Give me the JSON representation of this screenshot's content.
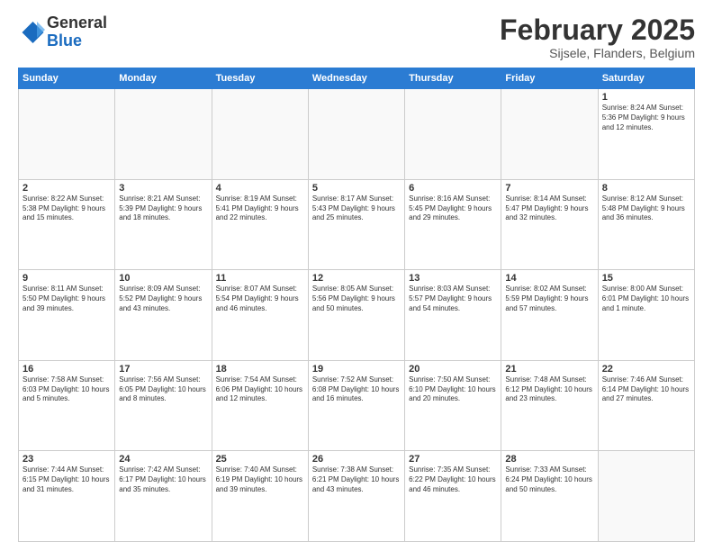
{
  "logo": {
    "general": "General",
    "blue": "Blue"
  },
  "title": "February 2025",
  "location": "Sijsele, Flanders, Belgium",
  "weekdays": [
    "Sunday",
    "Monday",
    "Tuesday",
    "Wednesday",
    "Thursday",
    "Friday",
    "Saturday"
  ],
  "weeks": [
    [
      {
        "day": "",
        "info": ""
      },
      {
        "day": "",
        "info": ""
      },
      {
        "day": "",
        "info": ""
      },
      {
        "day": "",
        "info": ""
      },
      {
        "day": "",
        "info": ""
      },
      {
        "day": "",
        "info": ""
      },
      {
        "day": "1",
        "info": "Sunrise: 8:24 AM\nSunset: 5:36 PM\nDaylight: 9 hours and 12 minutes."
      }
    ],
    [
      {
        "day": "2",
        "info": "Sunrise: 8:22 AM\nSunset: 5:38 PM\nDaylight: 9 hours and 15 minutes."
      },
      {
        "day": "3",
        "info": "Sunrise: 8:21 AM\nSunset: 5:39 PM\nDaylight: 9 hours and 18 minutes."
      },
      {
        "day": "4",
        "info": "Sunrise: 8:19 AM\nSunset: 5:41 PM\nDaylight: 9 hours and 22 minutes."
      },
      {
        "day": "5",
        "info": "Sunrise: 8:17 AM\nSunset: 5:43 PM\nDaylight: 9 hours and 25 minutes."
      },
      {
        "day": "6",
        "info": "Sunrise: 8:16 AM\nSunset: 5:45 PM\nDaylight: 9 hours and 29 minutes."
      },
      {
        "day": "7",
        "info": "Sunrise: 8:14 AM\nSunset: 5:47 PM\nDaylight: 9 hours and 32 minutes."
      },
      {
        "day": "8",
        "info": "Sunrise: 8:12 AM\nSunset: 5:48 PM\nDaylight: 9 hours and 36 minutes."
      }
    ],
    [
      {
        "day": "9",
        "info": "Sunrise: 8:11 AM\nSunset: 5:50 PM\nDaylight: 9 hours and 39 minutes."
      },
      {
        "day": "10",
        "info": "Sunrise: 8:09 AM\nSunset: 5:52 PM\nDaylight: 9 hours and 43 minutes."
      },
      {
        "day": "11",
        "info": "Sunrise: 8:07 AM\nSunset: 5:54 PM\nDaylight: 9 hours and 46 minutes."
      },
      {
        "day": "12",
        "info": "Sunrise: 8:05 AM\nSunset: 5:56 PM\nDaylight: 9 hours and 50 minutes."
      },
      {
        "day": "13",
        "info": "Sunrise: 8:03 AM\nSunset: 5:57 PM\nDaylight: 9 hours and 54 minutes."
      },
      {
        "day": "14",
        "info": "Sunrise: 8:02 AM\nSunset: 5:59 PM\nDaylight: 9 hours and 57 minutes."
      },
      {
        "day": "15",
        "info": "Sunrise: 8:00 AM\nSunset: 6:01 PM\nDaylight: 10 hours and 1 minute."
      }
    ],
    [
      {
        "day": "16",
        "info": "Sunrise: 7:58 AM\nSunset: 6:03 PM\nDaylight: 10 hours and 5 minutes."
      },
      {
        "day": "17",
        "info": "Sunrise: 7:56 AM\nSunset: 6:05 PM\nDaylight: 10 hours and 8 minutes."
      },
      {
        "day": "18",
        "info": "Sunrise: 7:54 AM\nSunset: 6:06 PM\nDaylight: 10 hours and 12 minutes."
      },
      {
        "day": "19",
        "info": "Sunrise: 7:52 AM\nSunset: 6:08 PM\nDaylight: 10 hours and 16 minutes."
      },
      {
        "day": "20",
        "info": "Sunrise: 7:50 AM\nSunset: 6:10 PM\nDaylight: 10 hours and 20 minutes."
      },
      {
        "day": "21",
        "info": "Sunrise: 7:48 AM\nSunset: 6:12 PM\nDaylight: 10 hours and 23 minutes."
      },
      {
        "day": "22",
        "info": "Sunrise: 7:46 AM\nSunset: 6:14 PM\nDaylight: 10 hours and 27 minutes."
      }
    ],
    [
      {
        "day": "23",
        "info": "Sunrise: 7:44 AM\nSunset: 6:15 PM\nDaylight: 10 hours and 31 minutes."
      },
      {
        "day": "24",
        "info": "Sunrise: 7:42 AM\nSunset: 6:17 PM\nDaylight: 10 hours and 35 minutes."
      },
      {
        "day": "25",
        "info": "Sunrise: 7:40 AM\nSunset: 6:19 PM\nDaylight: 10 hours and 39 minutes."
      },
      {
        "day": "26",
        "info": "Sunrise: 7:38 AM\nSunset: 6:21 PM\nDaylight: 10 hours and 43 minutes."
      },
      {
        "day": "27",
        "info": "Sunrise: 7:35 AM\nSunset: 6:22 PM\nDaylight: 10 hours and 46 minutes."
      },
      {
        "day": "28",
        "info": "Sunrise: 7:33 AM\nSunset: 6:24 PM\nDaylight: 10 hours and 50 minutes."
      },
      {
        "day": "",
        "info": ""
      }
    ]
  ]
}
